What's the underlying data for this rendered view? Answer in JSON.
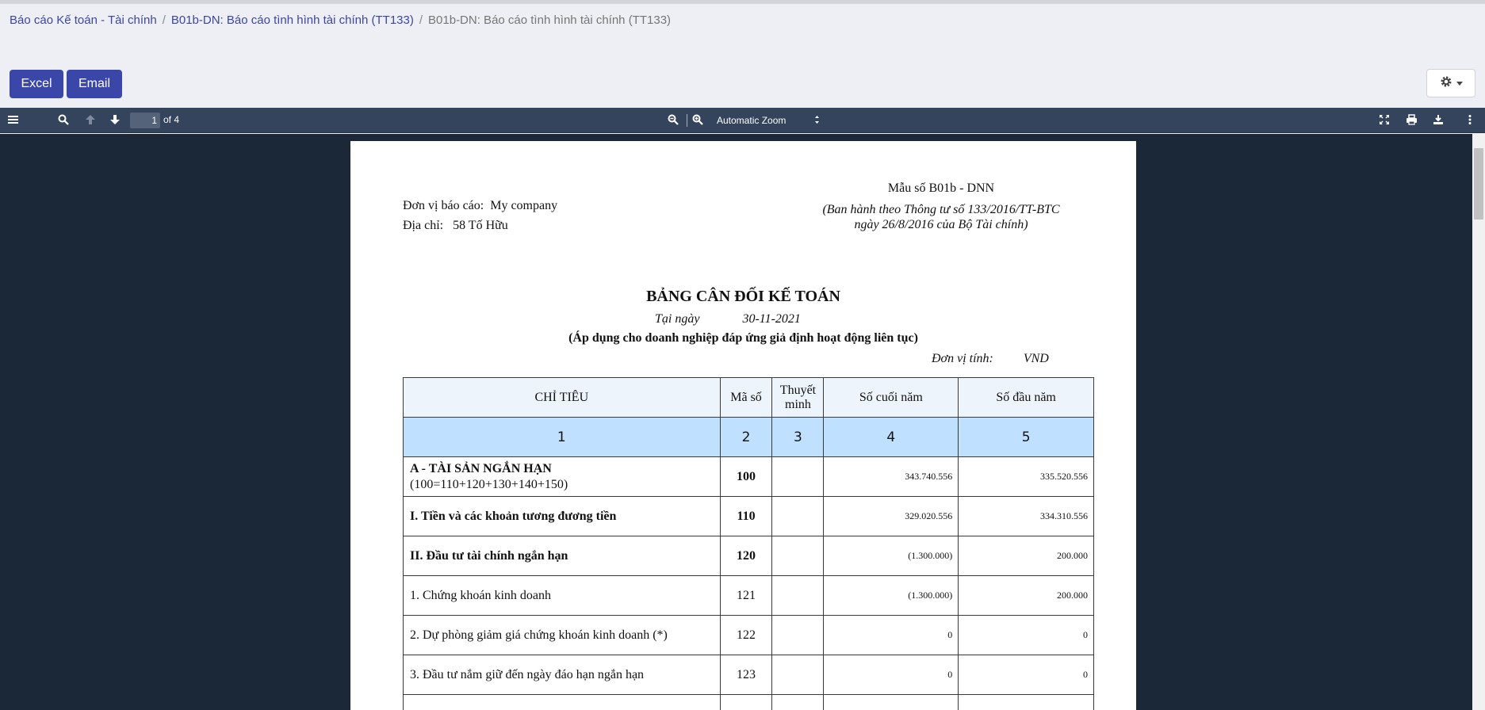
{
  "breadcrumb": {
    "item1": "Báo cáo Kế toán - Tài chính",
    "item2": "B01b-DN: Báo cáo tình hình tài chính (TT133)",
    "item3": "B01b-DN: Báo cáo tình hình tài chính (TT133)",
    "separator": "/"
  },
  "buttons": {
    "excel": "Excel",
    "email": "Email"
  },
  "viewer": {
    "page_current": "1",
    "page_total": "of 4",
    "zoom": "Automatic Zoom"
  },
  "report": {
    "company_label": "Đơn vị báo cáo:",
    "company_value": "My company",
    "address_label": "Địa chỉ:",
    "address_value": "58 Tố Hữu",
    "form_code": "Mẫu số B01b - DNN",
    "issued_line1": "(Ban hành theo Thông tư số 133/2016/TT-BTC",
    "issued_line2": "ngày 26/8/2016 của Bộ Tài chính)",
    "title": "BẢNG CÂN ĐỐI KẾ TOÁN",
    "date_label": "Tại ngày",
    "date_value": "30-11-2021",
    "apply_text": "(Áp dụng cho doanh nghiệp đáp ứng giả định hoạt động liên tục)",
    "unit_label": "Đơn vị tính:",
    "unit_value": "VND"
  },
  "table": {
    "headers": {
      "indicator": "CHỈ TIÊU",
      "code": "Mã số",
      "note_line1": "Thuyết",
      "note_line2": "minh",
      "end_year": "Số cuối năm",
      "begin_year": "Số đầu năm"
    },
    "numbering": [
      "1",
      "2",
      "3",
      "4",
      "5"
    ],
    "rows": [
      {
        "name": "A - TÀI SẢN NGẮN HẠN",
        "name2": "(100=110+120+130+140+150)",
        "code": "100",
        "note": "",
        "end": "343.740.556",
        "begin": "335.520.556"
      },
      {
        "name": "I. Tiền và các khoản tương đương tiền",
        "name2": "",
        "code": "110",
        "note": "",
        "end": "329.020.556",
        "begin": "334.310.556"
      },
      {
        "name": "II. Đầu tư tài chính ngắn hạn",
        "name2": "",
        "code": "120",
        "note": "",
        "end": "(1.300.000)",
        "begin": "200.000"
      },
      {
        "name": "1. Chứng khoán kinh doanh",
        "name2": "",
        "code": "121",
        "note": "",
        "end": "(1.300.000)",
        "begin": "200.000"
      },
      {
        "name": "2. Dự phòng giảm giá chứng khoán kinh doanh (*)",
        "name2": "",
        "code": "122",
        "note": "",
        "end": "0",
        "begin": "0"
      },
      {
        "name": "3. Đầu tư nắm giữ đến ngày đáo hạn ngắn hạn",
        "name2": "",
        "code": "123",
        "note": "",
        "end": "0",
        "begin": "0"
      }
    ]
  }
}
